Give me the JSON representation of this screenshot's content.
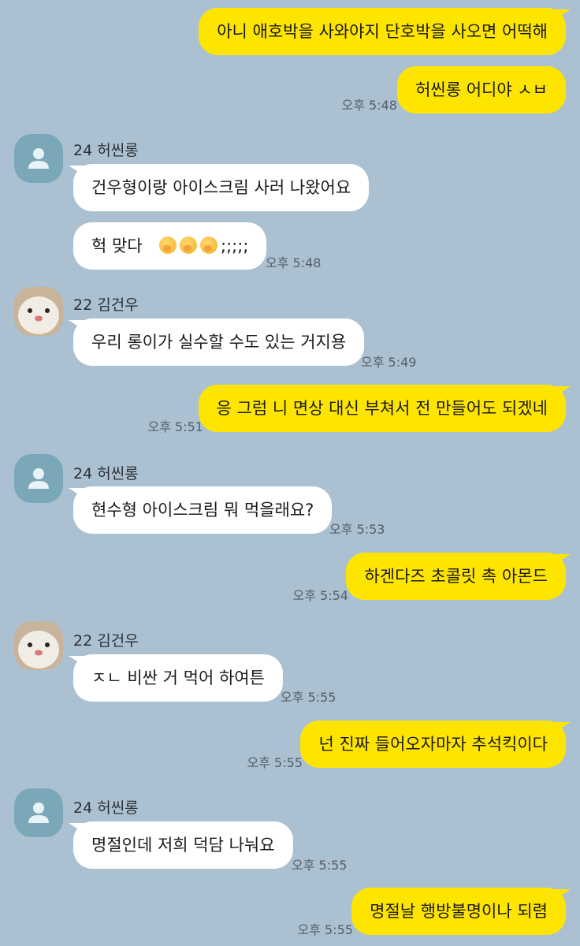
{
  "colors": {
    "background": "#abc1d1",
    "outgoing_bubble": "#fee500",
    "incoming_bubble": "#ffffff",
    "time_text": "#555d66"
  },
  "messages": {
    "m1": {
      "text": "아니 애호박을 사와야지 단호박을 사오면 어떡해"
    },
    "m2": {
      "text": "허씬롱 어디야 ㅅㅂ",
      "time": "오후 5:48"
    },
    "g1": {
      "sender": "24 허씬롱",
      "avatar": "default-profile-icon"
    },
    "m3": {
      "text": "건우형이랑 아이스크림 사러 나왔어요"
    },
    "m4": {
      "text": "헉 맞다",
      "emoji": "face-with-hand-over-mouth-emoji",
      "emoji_count": 3,
      "suffix": ";;;;;",
      "time": "오후 5:48"
    },
    "g2": {
      "sender": "22 김건우",
      "avatar": "hamster-photo"
    },
    "m5": {
      "text": "우리 롱이가 실수할 수도 있는 거지용",
      "time": "오후 5:49"
    },
    "m6": {
      "text": "응 그럼 니 면상 대신 부쳐서 전 만들어도 되겠네",
      "time": "오후 5:51"
    },
    "g3": {
      "sender": "24 허씬롱",
      "avatar": "default-profile-icon"
    },
    "m7": {
      "text": "현수형 아이스크림 뭐 먹을래요?",
      "time": "오후 5:53"
    },
    "m8": {
      "text": "하겐다즈 초콜릿 촉 아몬드",
      "time": "오후 5:54"
    },
    "g4": {
      "sender": "22 김건우",
      "avatar": "hamster-photo"
    },
    "m9": {
      "text": "ㅈㄴ 비싼 거 먹어 하여튼",
      "time": "오후 5:55"
    },
    "m10": {
      "text": "넌 진짜 들어오자마자 추석킥이다",
      "time": "오후 5:55"
    },
    "g5": {
      "sender": "24 허씬롱",
      "avatar": "default-profile-icon"
    },
    "m11": {
      "text": "명절인데 저희 덕담 나눠요",
      "time": "오후 5:55"
    },
    "m12": {
      "text": "명절날 행방불명이나 되렴",
      "time": "오후 5:55"
    }
  }
}
